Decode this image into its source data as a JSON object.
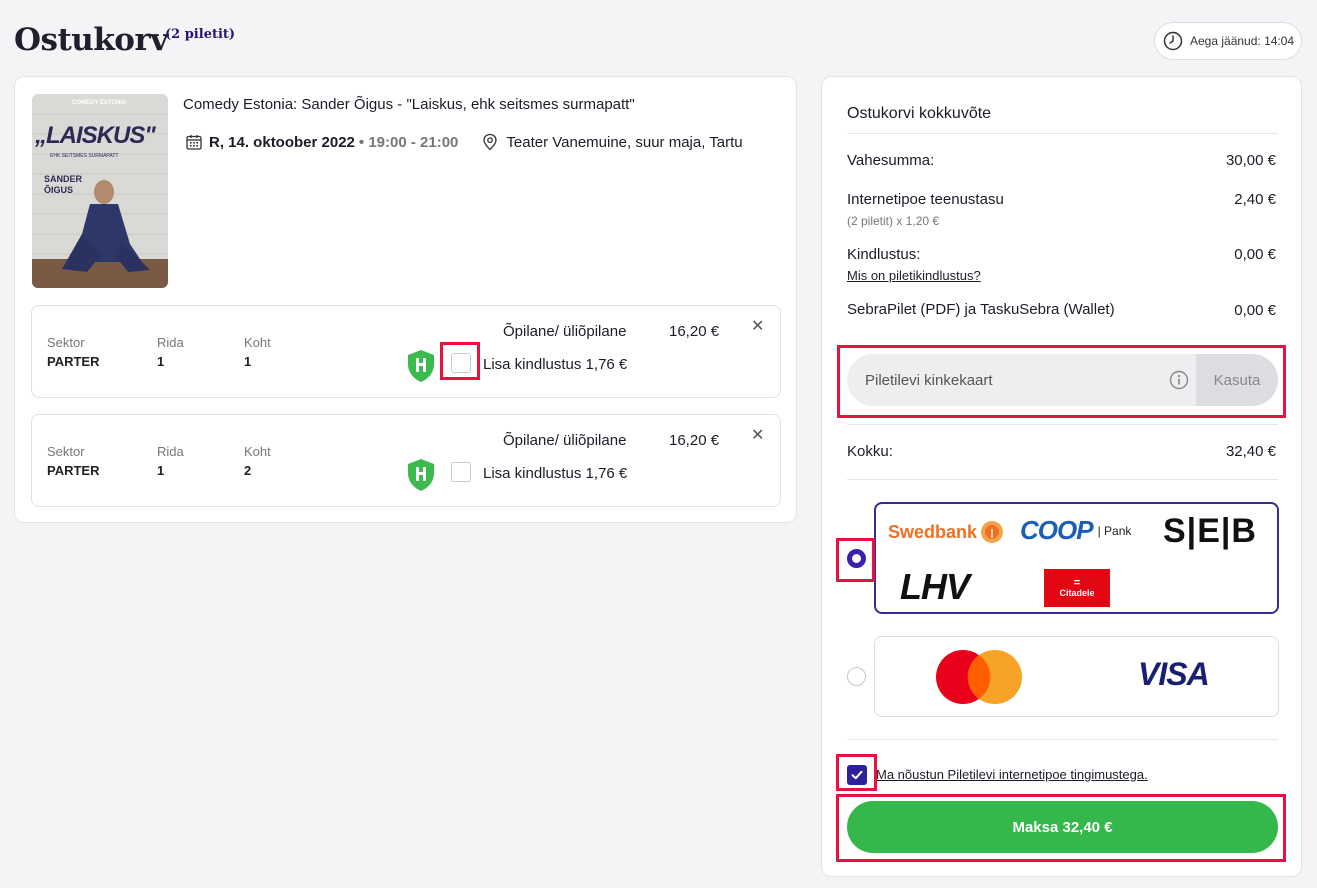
{
  "header": {
    "title": "Ostukorv",
    "ticket_count": "(2 piletit)",
    "timer": "Aega jäänud: 14:04"
  },
  "event": {
    "title": "Comedy Estonia: Sander Õigus - \"Laiskus, ehk seitsmes surmapatt\"",
    "date": "R, 14. oktoober 2022",
    "time": "• 19:00 - 21:00",
    "venue": "Teater Vanemuine, suur maja, Tartu",
    "poster": {
      "brand": "COMEDY ESTONIA",
      "headline": "„LAISKUS\"",
      "tagline": "EHK SEITSMES SURMAPATT",
      "performer": "SANDER ÕIGUS"
    }
  },
  "tickets": [
    {
      "sector_label": "Sektor",
      "sector": "PARTER",
      "row_label": "Rida",
      "row": "1",
      "seat_label": "Koht",
      "seat": "1",
      "type": "Õpilane/ üliõpilane",
      "price": "16,20 €",
      "insurance_label": "Lisa kindlustus 1,76 €",
      "remove": "✕"
    },
    {
      "sector_label": "Sektor",
      "sector": "PARTER",
      "row_label": "Rida",
      "row": "1",
      "seat_label": "Koht",
      "seat": "2",
      "type": "Õpilane/ üliõpilane",
      "price": "16,20 €",
      "insurance_label": "Lisa kindlustus 1,76 €",
      "remove": "✕"
    }
  ],
  "summary": {
    "title": "Ostukorvi kokkuvõte",
    "subtotal_label": "Vahesumma:",
    "subtotal": "30,00 €",
    "service_fee_label": "Internetipoe teenustasu",
    "service_fee_detail": "(2 piletit) x 1,20 €",
    "service_fee": "2,40 €",
    "insurance_label": "Kindlustus:",
    "insurance_link": "Mis on piletikindlustus?",
    "insurance": "0,00 €",
    "delivery_label": "SebraPilet (PDF) ja TaskuSebra (Wallet)",
    "delivery": "0,00 €",
    "gift_card_placeholder": "Piletilevi kinkekaart",
    "gift_card_apply": "Kasuta",
    "total_label": "Kokku:",
    "total": "32,40 €"
  },
  "payment": {
    "banks": {
      "swedbank": "Swedbank",
      "coop": "COOP",
      "coop_pank": "| Pank",
      "seb": "S|E|B",
      "lhv": "LHV",
      "citadele": "Citadele"
    },
    "cards": {
      "visa": "VISA"
    },
    "selected": "banks"
  },
  "terms": {
    "label": "Ma nõustun Piletilevi internetipoe tingimustega.",
    "checked": true
  },
  "pay_button": "Maksa 32,40 €",
  "colors": {
    "accent": "#3a1fb0",
    "pay_green": "#34b84c",
    "highlight": "#e8113f",
    "insurance_green": "#3dba4e"
  }
}
